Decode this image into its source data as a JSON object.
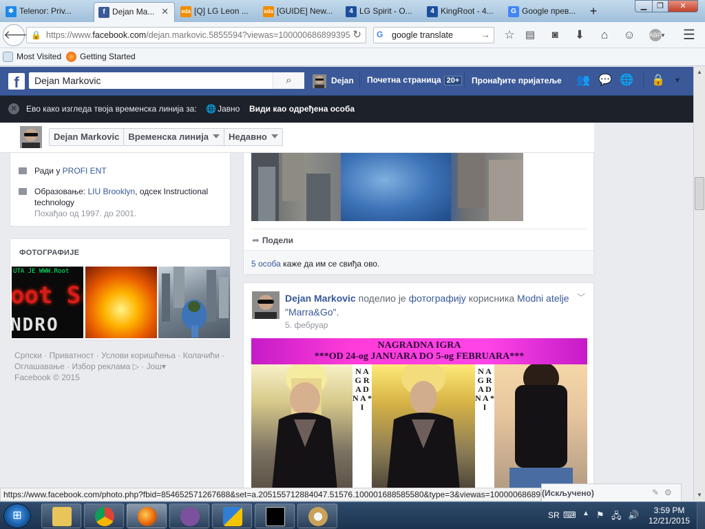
{
  "browser": {
    "tabs": [
      {
        "label": "Telenor: Priv...",
        "icon": "telenor-icon",
        "color": "#1e88e5"
      },
      {
        "label": "Dejan Ma...",
        "icon": "facebook-icon",
        "color": "#3b5998",
        "active": true
      },
      {
        "label": "[Q] LG Leon ...",
        "icon": "xda-icon",
        "color": "#f28c00"
      },
      {
        "label": "[GUIDE] New...",
        "icon": "xda-icon",
        "color": "#f28c00"
      },
      {
        "label": "LG Spirit - O...",
        "icon": "kingroot-icon",
        "color": "#1b4f9c"
      },
      {
        "label": "KingRoot - 4...",
        "icon": "kingroot-icon",
        "color": "#1b4f9c"
      },
      {
        "label": "Google прев...",
        "icon": "google-translate-icon",
        "color": "#4285f4"
      }
    ],
    "url_prefix": "https://www.",
    "url_domain": "facebook.com",
    "url_rest": "/dejan.markovic.5855594?viewas=100000686899395",
    "search_text": "google translate",
    "bookmarks": [
      "Most Visited",
      "Getting Started"
    ],
    "status_url": "https://www.facebook.com/photo.php?fbid=854652571267688&set=a.205155712884047.51576.100001688585580&type=3&viewas=100000686899395"
  },
  "fb": {
    "search_value": "Dejan Markovic",
    "header_user": "Dejan",
    "home_label": "Почетна страница",
    "home_badge": "20+",
    "find_friends": "Пронађите пријатеље",
    "viewas": {
      "text": "Ево како изгледа твоја временска линија за:",
      "audience": "Јавно",
      "link": "Види као одређена особа"
    },
    "timeline_nav": {
      "name": "Dejan Markovic",
      "timeline": "Временска линија",
      "recent": "Недавно"
    },
    "intro": {
      "work_prefix": "Ради у",
      "work_link": "PROFI ENT",
      "edu_prefix": "Образовање:",
      "edu_link": "LIU Brooklyn",
      "edu_rest_1": ", одсек Instructional",
      "edu_rest_2": "technology",
      "edu_years": "Похађао од 1997. до 2001."
    },
    "photos": {
      "title": "ФОТОГРАФИЈЕ",
      "thumb1_top": "UTA JE WWW.Root",
      "thumb1_mid": "oot Srb",
      "thumb1_bottom": "NDRO"
    },
    "footer": {
      "line1": [
        "Српски",
        "Приватност",
        "Услови коришћења",
        "Колачићи"
      ],
      "line2": [
        "Оглашавање",
        "Избор реклама",
        "Још"
      ],
      "copyright": "Facebook © 2015"
    },
    "post1": {
      "share": "Подели",
      "likes_link": "5 особа",
      "likes_text": "каже да им се свиђа ово."
    },
    "post2": {
      "author": "Dejan Markovic",
      "action": "поделио је",
      "photo_link": "фотографију",
      "of_user": "корисника",
      "page": "Modni atelje \"Marra&Go\"",
      "date": "5. фебруар",
      "banner_line1": "NAGRADNA IGRA",
      "banner_line2": "***OD 24-og JANUARA DO 5-og FEBRUARA***",
      "vertical_text": "N A G R A D N A * I"
    },
    "chat": "(Искључено)"
  },
  "taskbar": {
    "lang": "SR",
    "time": "3:59 PM",
    "date": "12/21/2015"
  }
}
